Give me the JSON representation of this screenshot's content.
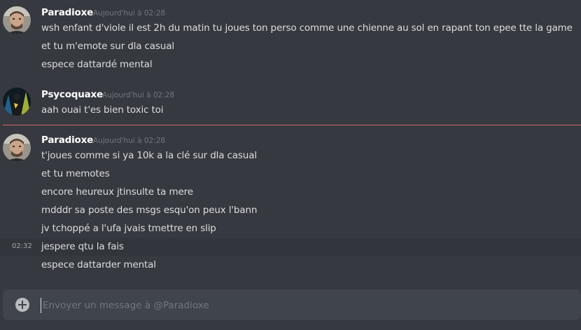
{
  "messages": [
    {
      "author": "Paradioxe",
      "timestamp": "Aujourd'hui à 02:28",
      "avatar": "paradioxe-avatar",
      "lines": [
        "wsh enfant d'viole il est 2h du matin tu joues ton perso comme une chienne au sol en rapant ton epee tte la game",
        "et tu m'emote sur dla casual",
        "espece dattardé mental"
      ]
    },
    {
      "author": "Psycoquaxe",
      "timestamp": "Aujourd'hui à 02:28",
      "avatar": "psycoquaxe-avatar",
      "lines": [
        "aah ouai t'es bien toxic toi"
      ]
    },
    {
      "author": "Paradioxe",
      "timestamp": "Aujourd'hui à 02:28",
      "avatar": "paradioxe-avatar",
      "lines": [
        "t'joues comme si ya 10k a la clé sur dla casual",
        "et tu memotes",
        "encore heureux jtinsulte ta mere",
        "mdddr sa poste des msgs esqu'on peux l'bann",
        "jv tchoppé a l'ufa jvais tmettre en slip",
        "jespere qtu la fais",
        "espece dattarder mental"
      ],
      "hovered_line_time": "02:32"
    }
  ],
  "composer": {
    "placeholder": "Envoyer un message à @Paradioxe",
    "attach_icon": "plus-circle-icon"
  },
  "colors": {
    "background": "#36393f",
    "composer": "#40444b",
    "new_messages_divider": "#d46a6a",
    "username": "#ffffff",
    "text": "#dcddde",
    "timestamp": "#72767d"
  }
}
